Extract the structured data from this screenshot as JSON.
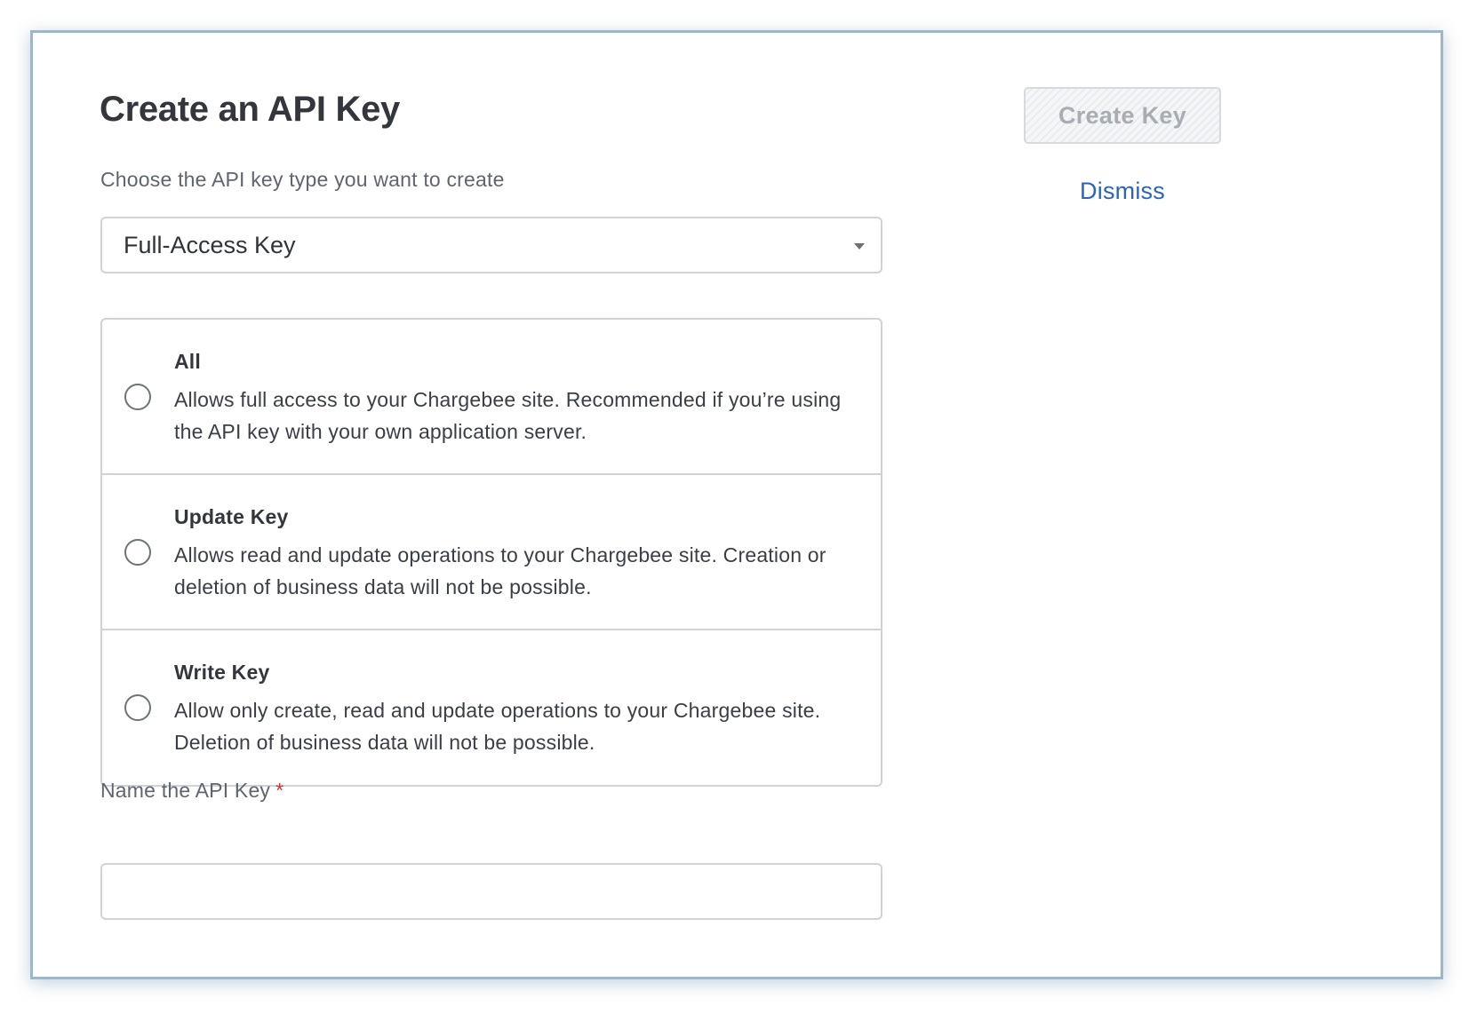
{
  "dialog": {
    "title": "Create an API Key"
  },
  "key_type": {
    "label": "Choose the API key type you want to create",
    "selected": "Full-Access Key"
  },
  "access_options": [
    {
      "title": "All",
      "description": "Allows full access to your Chargebee site. Recommended if you’re using the API key with your own application server.",
      "selected": false
    },
    {
      "title": "Update Key",
      "description": "Allows read and update operations to your Chargebee site. Creation or deletion of business data will not be possible.",
      "selected": false
    },
    {
      "title": "Write Key",
      "description": "Allow only create, read and update operations to your Chargebee site. Deletion of business data will not be possible.",
      "selected": false
    }
  ],
  "name_field": {
    "label": "Name the API Key",
    "required_mark": "*",
    "value": ""
  },
  "actions": {
    "create_label": "Create Key",
    "create_disabled": true,
    "dismiss_label": "Dismiss"
  },
  "colors": {
    "link": "#2e64b5",
    "required": "#d0312d",
    "panel_border": "#9fb6c9"
  }
}
